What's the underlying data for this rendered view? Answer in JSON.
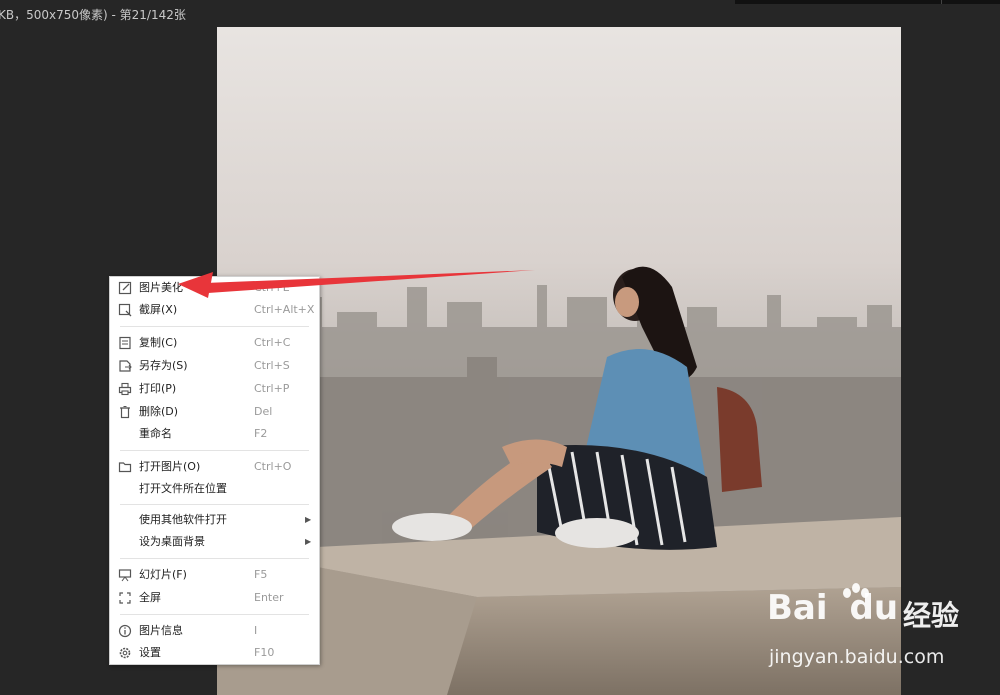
{
  "window": {
    "title": "KB，500x750像素) - 第21/142张"
  },
  "context_menu": {
    "items": [
      {
        "label": "图片美化",
        "shortcut": "Ctrl+E",
        "icon": "edit-icon"
      },
      {
        "label": "截屏(X)",
        "shortcut": "Ctrl+Alt+X",
        "icon": "screenshot-icon"
      },
      {
        "label": "复制(C)",
        "shortcut": "Ctrl+C",
        "icon": "copy-icon"
      },
      {
        "label": "另存为(S)",
        "shortcut": "Ctrl+S",
        "icon": "save-as-icon"
      },
      {
        "label": "打印(P)",
        "shortcut": "Ctrl+P",
        "icon": "print-icon"
      },
      {
        "label": "删除(D)",
        "shortcut": "Del",
        "icon": "trash-icon"
      },
      {
        "label": "重命名",
        "shortcut": "F2",
        "icon": ""
      },
      {
        "label": "打开图片(O)",
        "shortcut": "Ctrl+O",
        "icon": "folder-icon"
      },
      {
        "label": "打开文件所在位置",
        "shortcut": "",
        "icon": ""
      },
      {
        "label": "使用其他软件打开",
        "shortcut": "",
        "icon": "",
        "submenu": true
      },
      {
        "label": "设为桌面背景",
        "shortcut": "",
        "icon": "",
        "submenu": true
      },
      {
        "label": "幻灯片(F)",
        "shortcut": "F5",
        "icon": "slideshow-icon"
      },
      {
        "label": "全屏",
        "shortcut": "Enter",
        "icon": "fullscreen-icon"
      },
      {
        "label": "图片信息",
        "shortcut": "I",
        "icon": "info-icon"
      },
      {
        "label": "设置",
        "shortcut": "F10",
        "icon": "gear-icon"
      }
    ]
  },
  "watermark": {
    "brand_latin": "Bai",
    "brand_du": "du",
    "brand_cn": "经验",
    "url": "jingyan.baidu.com"
  },
  "colors": {
    "background": "#262626",
    "annotation_arrow": "#e8353a",
    "menu_background": "#ffffff"
  }
}
